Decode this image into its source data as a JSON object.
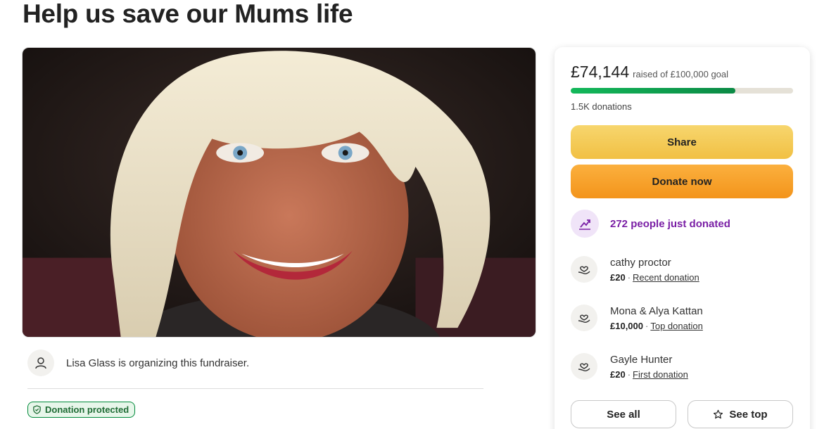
{
  "page": {
    "title": "Help us save our Mums life"
  },
  "organizer": {
    "text": "Lisa Glass is organizing this fundraiser.",
    "icon": "user-icon"
  },
  "badge": {
    "label": "Donation protected",
    "icon": "shield-icon"
  },
  "progress": {
    "raised": "£74,144",
    "goal_text": "raised of £100,000 goal",
    "percent": 74,
    "donations_count": "1.5K donations"
  },
  "actions": {
    "share_label": "Share",
    "donate_label": "Donate now"
  },
  "trending": {
    "text": "272 people just donated",
    "icon": "trend-up-icon"
  },
  "donors": [
    {
      "name": "cathy proctor",
      "amount": "£20",
      "type": "Recent donation",
      "icon": "heart-hand-icon"
    },
    {
      "name": "Mona & Alya Kattan",
      "amount": "£10,000",
      "type": "Top donation",
      "icon": "heart-hand-icon"
    },
    {
      "name": "Gayle Hunter",
      "amount": "£20",
      "type": "First donation",
      "icon": "heart-hand-icon"
    }
  ],
  "footer_buttons": {
    "see_all": "See all",
    "see_top": "See top",
    "see_top_icon": "star-icon"
  },
  "colors": {
    "progress_fill": "#0b8a45",
    "share_button": "#f1c043",
    "donate_button": "#f3941b",
    "trending_text": "#7a1fa5",
    "badge_green": "#008a3a"
  },
  "separator": "·"
}
